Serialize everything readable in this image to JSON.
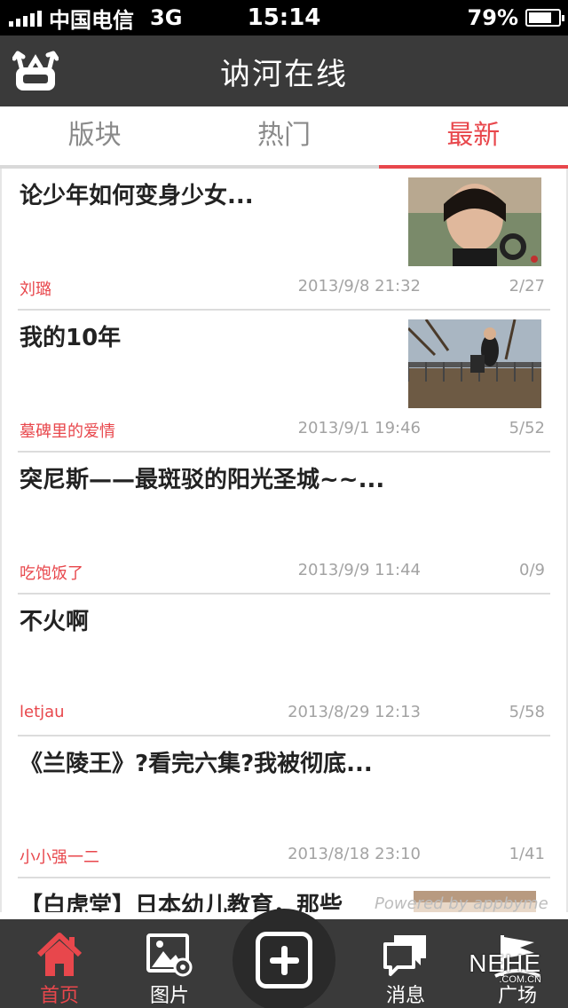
{
  "status_bar": {
    "carrier": "中国电信",
    "network": "3G",
    "time": "15:14",
    "battery": "79%",
    "battery_level": 0.79
  },
  "nav": {
    "title": "讷河在线"
  },
  "tabs": [
    {
      "label": "版块",
      "active": false
    },
    {
      "label": "热门",
      "active": false
    },
    {
      "label": "最新",
      "active": true
    }
  ],
  "posts": [
    {
      "title": "论少年如何变身少女...",
      "author": "刘璐",
      "date": "2013/9/8 21:32",
      "count": "2/27",
      "thumbnail": "portrait-photo"
    },
    {
      "title": "我的10年",
      "author": "墓碑里的爱情",
      "date": "2013/9/1 19:46",
      "count": "5/52",
      "thumbnail": "bridge-photo"
    },
    {
      "title": "突尼斯——最斑驳的阳光圣城~~...",
      "author": "吃饱饭了",
      "date": "2013/9/9 11:44",
      "count": "0/9"
    },
    {
      "title": "不火啊",
      "author": "letjau",
      "date": "2013/8/29 12:13",
      "count": "5/58"
    },
    {
      "title": "《兰陵王》?看完六集?我被彻底...",
      "author": "小小强一二",
      "date": "2013/8/18 23:10",
      "count": "1/41"
    },
    {
      "title": "【白虎堂】日本幼儿教育，那些",
      "author": "",
      "date": "",
      "count": "",
      "thumbnail": "partial-photo"
    }
  ],
  "watermark": {
    "powered": "Powered by appbyme",
    "brand": "NEHE",
    "brand_sub": ".COM.CN"
  },
  "tab_bar": [
    {
      "label": "首页",
      "icon": "home-icon",
      "active": true
    },
    {
      "label": "图片",
      "icon": "picture-icon",
      "active": false
    },
    {
      "label": "",
      "icon": "plus-icon",
      "active": false
    },
    {
      "label": "消息",
      "icon": "message-icon",
      "active": false
    },
    {
      "label": "广场",
      "icon": "plaza-icon",
      "active": false
    }
  ],
  "colors": {
    "accent": "#e8474c",
    "bar_background": "#3a3a3a",
    "meta_text": "#a3a3a3"
  }
}
